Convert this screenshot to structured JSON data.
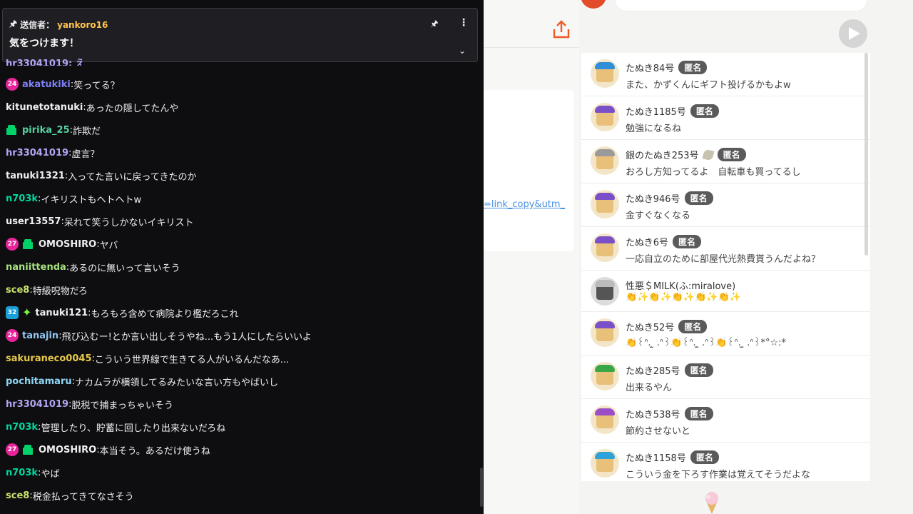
{
  "pinned": {
    "sender_label": "送信者：",
    "sender": "yankoro16",
    "message": "気をつけます！"
  },
  "chat": {
    "cut_top": "hr33041019: え",
    "rows": [
      {
        "badge": "24",
        "gift": false,
        "star": false,
        "box": "",
        "user": "akatukiki",
        "color": "#7f7ff5",
        "text": "笑ってる？"
      },
      {
        "badge": "",
        "gift": false,
        "star": false,
        "box": "",
        "user": "kitunetotanuki",
        "color": "#efeff1",
        "text": "あったの隠してたんや"
      },
      {
        "badge": "",
        "gift": true,
        "star": false,
        "box": "",
        "user": "pirika_25",
        "color": "#54d3a0",
        "text": "詐欺だ"
      },
      {
        "badge": "",
        "gift": false,
        "star": false,
        "box": "",
        "user": "hr33041019",
        "color": "#b3a5f5",
        "text": "虚言？"
      },
      {
        "badge": "",
        "gift": false,
        "star": false,
        "box": "",
        "user": "tanuki1321",
        "color": "#efeff1",
        "text": "入ってた言いに戻ってきたのか"
      },
      {
        "badge": "",
        "gift": false,
        "star": false,
        "box": "",
        "user": "n703k",
        "color": "#00d8a0",
        "text": "イキリストもヘトヘトw"
      },
      {
        "badge": "",
        "gift": false,
        "star": false,
        "box": "",
        "user": "user13557",
        "color": "#efeff1",
        "text": "呆れて笑うしかないイキリスト"
      },
      {
        "badge": "27",
        "gift": true,
        "star": false,
        "box": "",
        "user": "OMOSHIRO",
        "color": "#efeff1",
        "text": "ヤバ"
      },
      {
        "badge": "",
        "gift": false,
        "star": false,
        "box": "",
        "user": "naniittenda",
        "color": "#a6e07e",
        "text": "あるのに無いって言いそう"
      },
      {
        "badge": "",
        "gift": false,
        "star": false,
        "box": "",
        "user": "sce8",
        "color": "#c9e36a",
        "text": "特級呪物だろ"
      },
      {
        "badge": "",
        "gift": false,
        "star": true,
        "box": "32",
        "user": "tanuki121",
        "color": "#efeff1",
        "text": "もろもろ含めて病院より檻だろこれ"
      },
      {
        "badge": "24",
        "gift": false,
        "star": false,
        "box": "",
        "user": "tanajin",
        "color": "#8fc7f0",
        "text": "飛び込むー!とか言い出しそうやね...もう1人にしたらいいよ"
      },
      {
        "badge": "",
        "gift": false,
        "star": false,
        "box": "",
        "user": "sakuraneco0045",
        "color": "#e6c94a",
        "text": "こういう世界線で生きてる人がいるんだなあ..."
      },
      {
        "badge": "",
        "gift": false,
        "star": false,
        "box": "",
        "user": "pochitamaru",
        "color": "#8fd6f5",
        "text": "ナカムラが横領してるみたいな言い方もやばいし"
      },
      {
        "badge": "",
        "gift": false,
        "star": false,
        "box": "",
        "user": "hr33041019",
        "color": "#b3a5f5",
        "text": "脱税で捕まっちゃいそう"
      },
      {
        "badge": "",
        "gift": false,
        "star": false,
        "box": "",
        "user": "n703k",
        "color": "#00d8a0",
        "text": "管理したり、貯蓄に回したり出来ないだろね"
      },
      {
        "badge": "27",
        "gift": true,
        "star": false,
        "box": "",
        "user": "OMOSHIRO",
        "color": "#efeff1",
        "text": "本当そう。あるだけ使うね"
      },
      {
        "badge": "",
        "gift": false,
        "star": false,
        "box": "",
        "user": "n703k",
        "color": "#00d8a0",
        "text": "やば"
      },
      {
        "badge": "",
        "gift": false,
        "star": false,
        "box": "",
        "user": "sce8",
        "color": "#c9e36a",
        "text": "税金払ってきてなさそう"
      }
    ]
  },
  "middle": {
    "link_text": "=link_copy&utm_"
  },
  "comments": [
    {
      "name": "たぬき84号",
      "anon": "匿名",
      "text": "また、かずくんにギフト投げるかもよw",
      "cap": "#2f8fd9",
      "leaf": false,
      "short": false
    },
    {
      "name": "たぬき1185号",
      "anon": "匿名",
      "text": "勉強になるね",
      "cap": "#7b4fc8",
      "leaf": false,
      "short": false
    },
    {
      "name": "銀のたぬき253号",
      "anon": "匿名",
      "text": "おろし方知ってるよ　自転車も買ってるし",
      "cap": "#9a9a9a",
      "leaf": true,
      "short": false
    },
    {
      "name": "たぬき946号",
      "anon": "匿名",
      "text": "金すぐなくなる",
      "cap": "#7b4fc8",
      "leaf": false,
      "short": false
    },
    {
      "name": "たぬき6号",
      "anon": "匿名",
      "text": "一応自立のために部屋代光熱費貰うんだよね？",
      "cap": "#7b4fc8",
      "leaf": false,
      "short": false
    },
    {
      "name": "性悪＄MILK(ふ:miralove)",
      "anon": "",
      "text": "👏✨👏✨👏✨👏✨👏✨",
      "cap": "#bbbbbb",
      "leaf": false,
      "short": true
    },
    {
      "name": "たぬき52号",
      "anon": "匿名",
      "text": "👏꒰ᐢ. ̫ .ᐢ꒱👏꒰ᐢ. ̫ .ᐢ꒱👏꒰ᐢ. ̫ .ᐢ꒱*°☆:*",
      "cap": "#7b4fc8",
      "leaf": false,
      "short": false
    },
    {
      "name": "たぬき285号",
      "anon": "匿名",
      "text": "出来るやん",
      "cap": "#3aa64a",
      "leaf": false,
      "short": false
    },
    {
      "name": "たぬき538号",
      "anon": "匿名",
      "text": "節約させないと",
      "cap": "#9a4fc8",
      "leaf": false,
      "short": false
    },
    {
      "name": "たぬき1158号",
      "anon": "匿名",
      "text": "こういう金を下ろす作業は覚えてそうだよな",
      "cap": "#2fa3d9",
      "leaf": false,
      "short": false
    }
  ]
}
